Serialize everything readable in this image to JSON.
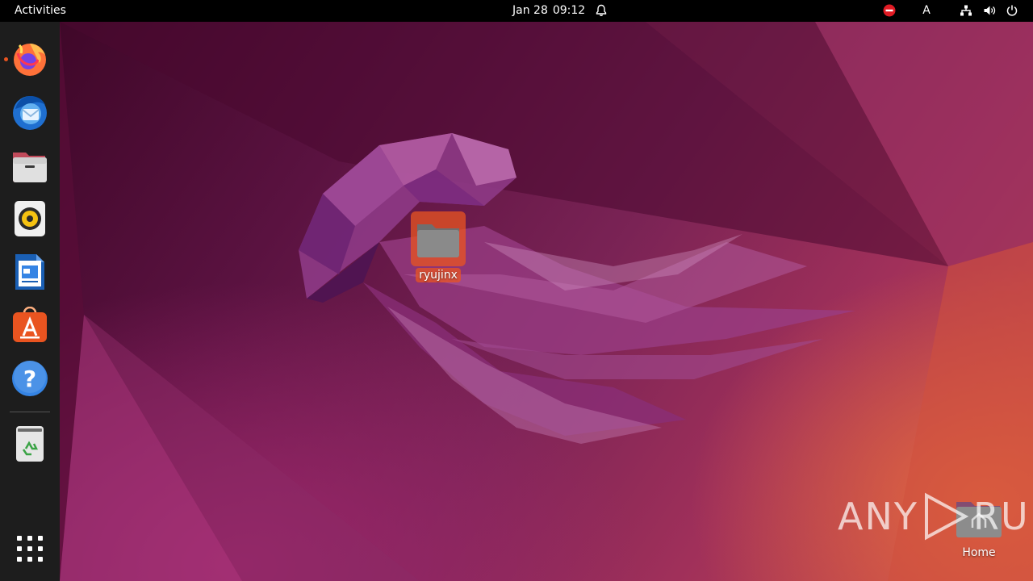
{
  "topbar": {
    "activities": "Activities",
    "date": "Jan 28",
    "time": "09:12",
    "input_source": "A",
    "icons": [
      "notification-bell-icon",
      "do-not-disturb-icon",
      "network-icon",
      "volume-icon",
      "power-icon"
    ]
  },
  "dock": {
    "items": [
      {
        "name": "Firefox",
        "icon": "firefox-icon",
        "running": true
      },
      {
        "name": "Thunderbird",
        "icon": "thunderbird-icon"
      },
      {
        "name": "Files",
        "icon": "files-icon"
      },
      {
        "name": "Rhythmbox",
        "icon": "rhythmbox-icon"
      },
      {
        "name": "LibreOffice Writer",
        "icon": "writer-icon"
      },
      {
        "name": "Ubuntu Software",
        "icon": "software-icon"
      },
      {
        "name": "Help",
        "icon": "help-icon"
      },
      {
        "name": "Trash",
        "icon": "trash-icon"
      },
      {
        "name": "Show Applications",
        "icon": "app-grid-icon"
      }
    ]
  },
  "desktop": {
    "icons": [
      {
        "label": "ryujinx",
        "type": "folder",
        "selected": true
      },
      {
        "label": "Home",
        "type": "home-folder",
        "selected": false
      }
    ]
  },
  "watermark": {
    "text_left": "ANY",
    "text_right": "RUN"
  },
  "colors": {
    "accent": "#e95420",
    "topbar": "#000000",
    "dock": "#1d1d1d"
  }
}
